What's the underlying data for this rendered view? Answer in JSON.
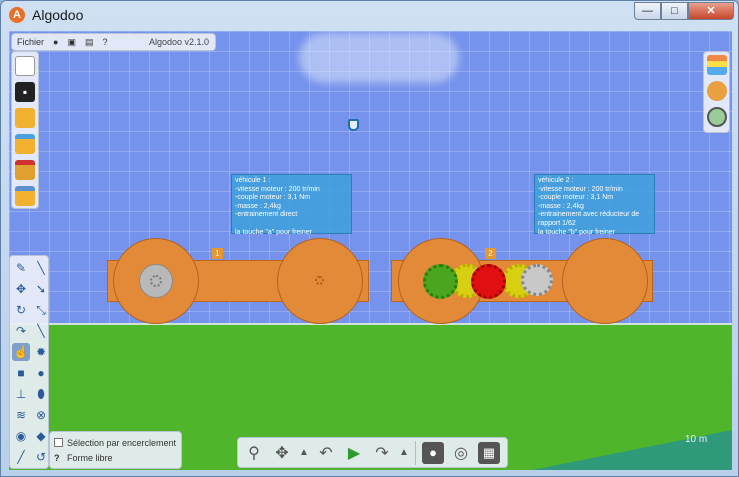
{
  "window": {
    "title": "Algodoo",
    "min": "—",
    "max": "□",
    "close": "✕"
  },
  "menubar": {
    "file": "Fichier",
    "help": "?",
    "version": "Algodoo v2.1.0"
  },
  "vehicles": [
    {
      "tag": "1",
      "info": "véhicule 1 :\n-vitesse moteur : 200 tr/min\n-couple moteur : 3,1 Nm\n-masse : 2,4kg\n-entrainement direct\n\nla touche \"a\" pour freiner"
    },
    {
      "tag": "2",
      "info": "véhicule 2 :\n-vitesse moteur : 200 tr/min\n-couple moteur : 3,1 Nm\n-masse : 2,4kg\n-entrainement avec réducteur de\nrapport 1/62\nla touche \"b\" pour freiner"
    }
  ],
  "options": {
    "lasso": "Sélection par encerclement",
    "help_label": "?",
    "shape": "Forme libre"
  },
  "scale_label": "10 m",
  "colors": {
    "sky": "#7592ec",
    "ground": "#4fb52a",
    "wood": "#e38a39",
    "info": "#3ea0dc"
  }
}
